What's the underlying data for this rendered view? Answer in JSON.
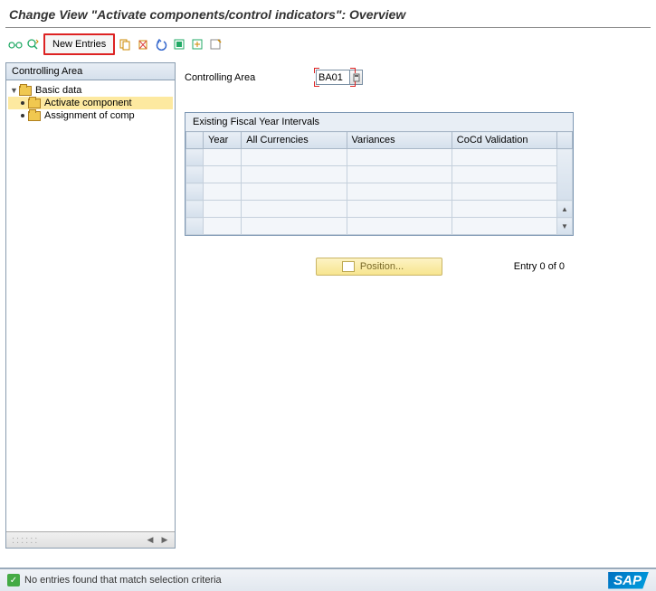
{
  "title": "Change View \"Activate components/control indicators\": Overview",
  "toolbar": {
    "new_entries": "New Entries"
  },
  "sidebar": {
    "header": "Controlling Area",
    "items": [
      {
        "label": "Basic data"
      },
      {
        "label": "Activate component"
      },
      {
        "label": "Assignment of comp"
      }
    ]
  },
  "form": {
    "controlling_area_label": "Controlling Area",
    "controlling_area_value": "BA01"
  },
  "table": {
    "title": "Existing Fiscal Year Intervals",
    "headers": {
      "year": "Year",
      "all_currencies": "All Currencies",
      "variances": "Variances",
      "cocd_validation": "CoCd Validation"
    }
  },
  "position": {
    "button_label": "Position...",
    "entry_text": "Entry 0 of 0"
  },
  "status": {
    "message": "No entries found that match selection criteria",
    "logo": "SAP"
  }
}
